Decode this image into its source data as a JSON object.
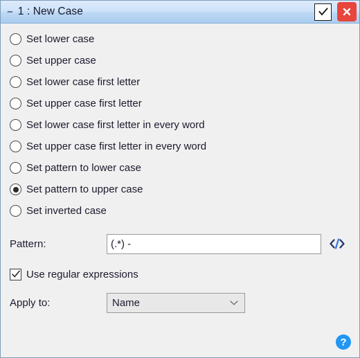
{
  "window": {
    "title": "1 : New Case",
    "collapse_glyph": "−",
    "accept_icon": "checkmark-icon",
    "close_icon": "close-x-icon",
    "accent_blue": "#2196f3",
    "close_red": "#e8453c",
    "titlebar_blue": "#cfe3f9",
    "body_background": "#f0f0f0"
  },
  "options": [
    {
      "label": "Set lower case",
      "selected": false
    },
    {
      "label": "Set upper case",
      "selected": false
    },
    {
      "label": "Set lower case first letter",
      "selected": false
    },
    {
      "label": "Set upper case first letter",
      "selected": false
    },
    {
      "label": "Set lower case first letter in every word",
      "selected": false
    },
    {
      "label": "Set upper case first letter in every word",
      "selected": false
    },
    {
      "label": "Set pattern to lower case",
      "selected": false
    },
    {
      "label": "Set pattern to upper case",
      "selected": true
    },
    {
      "label": "Set inverted case",
      "selected": false
    }
  ],
  "pattern": {
    "label": "Pattern:",
    "value": "(.*) -",
    "placeholder": "",
    "code_icon": "code-brackets-icon"
  },
  "regex": {
    "label": "Use regular expressions",
    "checked": true
  },
  "apply_to": {
    "label": "Apply to:",
    "value": "Name",
    "chevron_icon": "chevron-down-icon"
  },
  "help": {
    "glyph": "?",
    "icon": "help-question-icon"
  }
}
